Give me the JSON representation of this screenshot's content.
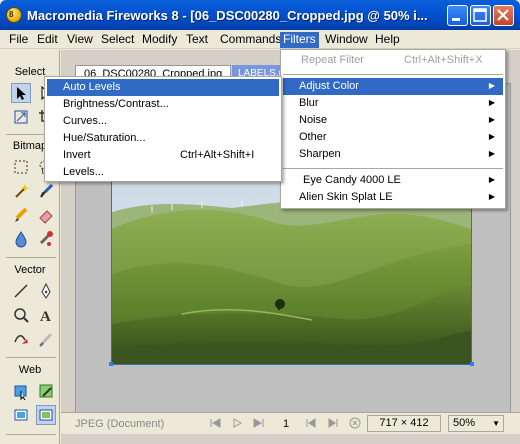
{
  "window": {
    "title": "Macromedia Fireworks 8 - [06_DSC00280_Cropped.jpg @  50% i...",
    "app_icon_text": "8"
  },
  "menubar": {
    "items": [
      {
        "label": "File",
        "active": false
      },
      {
        "label": "Edit",
        "active": false
      },
      {
        "label": "View",
        "active": false
      },
      {
        "label": "Select",
        "active": false
      },
      {
        "label": "Modify",
        "active": false
      },
      {
        "label": "Text",
        "active": false
      },
      {
        "label": "Commands",
        "active": false
      },
      {
        "label": "Filters",
        "active": true
      },
      {
        "label": "Window",
        "active": false
      },
      {
        "label": "Help",
        "active": false
      }
    ]
  },
  "tools": {
    "sections": [
      "Select",
      "Bitmap",
      "Vector",
      "Web"
    ],
    "icons": [
      "pointer-icon",
      "subselect-icon",
      "scale-icon",
      "crop-icon",
      "marquee-icon",
      "lasso-icon",
      "magic-wand-icon",
      "brush-icon",
      "pencil-icon",
      "eraser-icon",
      "blur-icon",
      "rubber-stamp-icon",
      "line-icon",
      "pen-icon",
      "ellipse-icon",
      "text-icon",
      "freeform-icon",
      "knife-icon",
      "hotspot-icon",
      "slice-icon",
      "hide-slices-icon",
      "show-slices-icon"
    ]
  },
  "document": {
    "tab_label": "06_DSC00280_Cropped.jpg",
    "labels_tab": "LABELS.n",
    "status_label": "JPEG (Document)",
    "page_number": "1",
    "dimensions": "717 × 412",
    "zoom": "50%"
  },
  "filters_menu": {
    "items": [
      {
        "label": "Repeat Filter",
        "shortcut": "Ctrl+Alt+Shift+X",
        "disabled": true,
        "submenu": false,
        "highlight": false
      },
      {
        "label": "Adjust Color",
        "shortcut": "",
        "disabled": false,
        "submenu": true,
        "highlight": true
      },
      {
        "label": "Blur",
        "shortcut": "",
        "disabled": false,
        "submenu": true,
        "highlight": false
      },
      {
        "label": "Noise",
        "shortcut": "",
        "disabled": false,
        "submenu": true,
        "highlight": false
      },
      {
        "label": "Other",
        "shortcut": "",
        "disabled": false,
        "submenu": true,
        "highlight": false
      },
      {
        "label": "Sharpen",
        "shortcut": "",
        "disabled": false,
        "submenu": true,
        "highlight": false
      },
      {
        "label": "Eye Candy 4000 LE",
        "shortcut": "",
        "disabled": false,
        "submenu": true,
        "highlight": false
      },
      {
        "label": "Alien Skin Splat LE",
        "shortcut": "",
        "disabled": false,
        "submenu": true,
        "highlight": false
      }
    ]
  },
  "adjust_color_menu": {
    "items": [
      {
        "label": "Auto Levels",
        "shortcut": "",
        "highlight": true
      },
      {
        "label": "Brightness/Contrast...",
        "shortcut": "",
        "highlight": false
      },
      {
        "label": "Curves...",
        "shortcut": "",
        "highlight": false
      },
      {
        "label": "Hue/Saturation...",
        "shortcut": "",
        "highlight": false
      },
      {
        "label": "Invert",
        "shortcut": "Ctrl+Alt+Shift+I",
        "highlight": false
      },
      {
        "label": "Levels...",
        "shortcut": "",
        "highlight": false
      }
    ]
  },
  "colors": {
    "titlebar": "#0453d1",
    "menu_highlight": "#316ac5",
    "canvas_border": "#2a7fff"
  }
}
